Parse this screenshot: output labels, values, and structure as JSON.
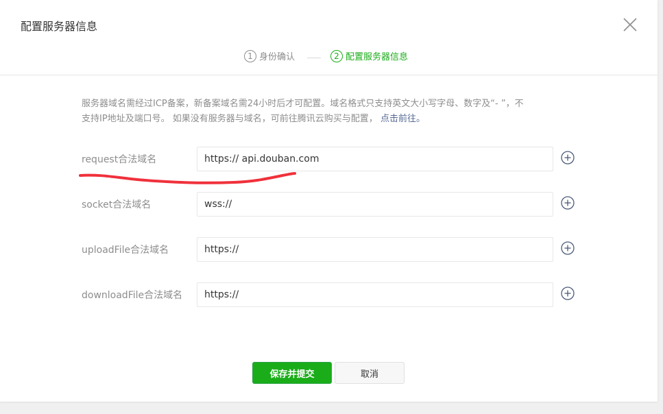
{
  "dialog": {
    "title": "配置服务器信息"
  },
  "steps": [
    {
      "number": "1",
      "label": "身份确认",
      "state": "done"
    },
    {
      "number": "2",
      "label": "配置服务器信息",
      "state": "active"
    }
  ],
  "notice": {
    "text_line1": "服务器域名需经过ICP备案，新备案域名需24小时后才可配置。域名格式只支持英文大小写字母、数字及“- ”，不",
    "text_line2": "支持IP地址及端口号。 如果没有服务器与域名，可前往腾讯云购买与配置，",
    "link": "点击前往。"
  },
  "form": {
    "rows": [
      {
        "label": "request合法域名",
        "value": "https:// api.douban.com"
      },
      {
        "label": "socket合法域名",
        "value": "wss://"
      },
      {
        "label": "uploadFile合法域名",
        "value": "https://"
      },
      {
        "label": "downloadFile合法域名",
        "value": "https://"
      }
    ]
  },
  "buttons": {
    "submit": "保存并提交",
    "cancel": "取消"
  },
  "colors": {
    "accent": "#1aad19",
    "link": "#576b95",
    "annotation": "#f0313b"
  },
  "icons": {
    "close": "close-icon",
    "add": "plus-circle-icon"
  }
}
